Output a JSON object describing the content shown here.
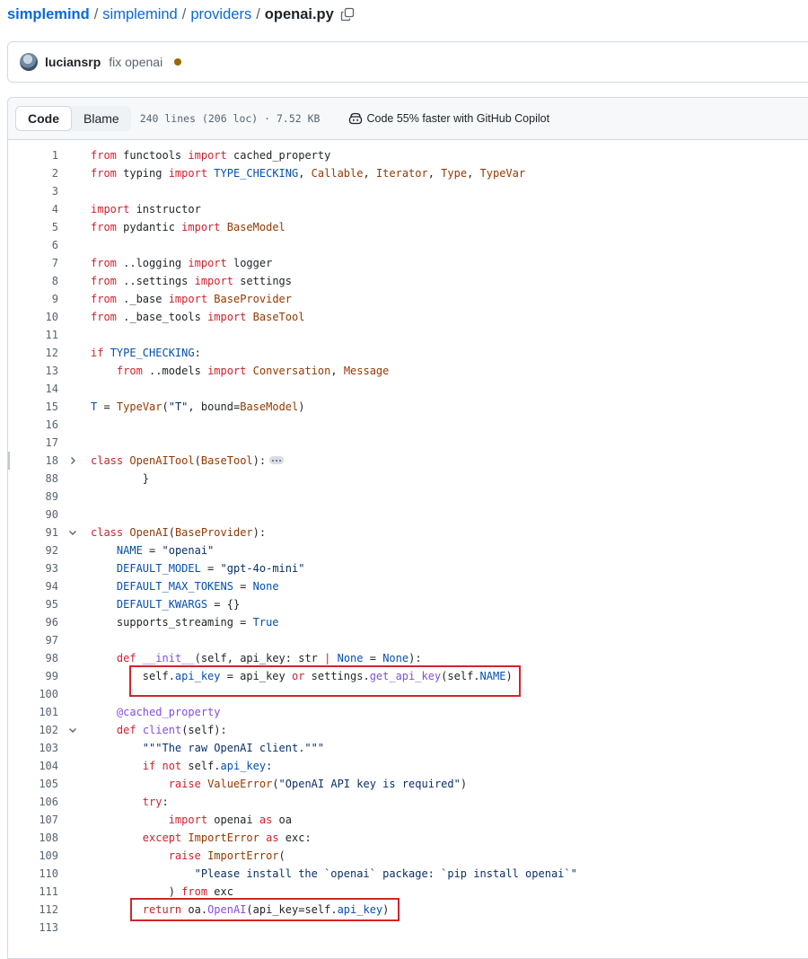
{
  "breadcrumb": {
    "repo": "simplemind",
    "sep": "/",
    "dir1": "simplemind",
    "dir2": "providers",
    "file": "openai.py"
  },
  "commit": {
    "author": "luciansrp",
    "message": "fix openai",
    "status_color": "#9a6700"
  },
  "file_header": {
    "code_tab": "Code",
    "blame_tab": "Blame",
    "meta": "240 lines (206 loc) · 7.52 KB",
    "copilot_label": "Code 55% faster with GitHub Copilot"
  },
  "code_lines": [
    {
      "n": "1",
      "html": "<span class=\"k\">from</span> functools <span class=\"k\">import</span> cached_property"
    },
    {
      "n": "2",
      "html": "<span class=\"k\">from</span> typing <span class=\"k\">import</span> <span class=\"b\">TYPE_CHECKING</span>, <span class=\"c\">Callable</span>, <span class=\"c\">Iterator</span>, <span class=\"c\">Type</span>, <span class=\"c\">TypeVar</span>"
    },
    {
      "n": "3",
      "html": ""
    },
    {
      "n": "4",
      "html": "<span class=\"k\">import</span> instructor"
    },
    {
      "n": "5",
      "html": "<span class=\"k\">from</span> pydantic <span class=\"k\">import</span> <span class=\"c\">BaseModel</span>"
    },
    {
      "n": "6",
      "html": ""
    },
    {
      "n": "7",
      "html": "<span class=\"k\">from</span> ..logging <span class=\"k\">import</span> logger"
    },
    {
      "n": "8",
      "html": "<span class=\"k\">from</span> ..settings <span class=\"k\">import</span> settings"
    },
    {
      "n": "9",
      "html": "<span class=\"k\">from</span> ._base <span class=\"k\">import</span> <span class=\"c\">BaseProvider</span>"
    },
    {
      "n": "10",
      "html": "<span class=\"k\">from</span> ._base_tools <span class=\"k\">import</span> <span class=\"c\">BaseTool</span>"
    },
    {
      "n": "11",
      "html": ""
    },
    {
      "n": "12",
      "html": "<span class=\"k\">if</span> <span class=\"b\">TYPE_CHECKING</span>:"
    },
    {
      "n": "13",
      "html": "    <span class=\"k\">from</span> ..models <span class=\"k\">import</span> <span class=\"c\">Conversation</span>, <span class=\"c\">Message</span>"
    },
    {
      "n": "14",
      "html": ""
    },
    {
      "n": "15",
      "html": "<span class=\"b\">T</span> = <span class=\"c\">TypeVar</span>(<span class=\"s\">\"T\"</span>, bound=<span class=\"c\">BaseModel</span>)"
    },
    {
      "n": "16",
      "html": ""
    },
    {
      "n": "17",
      "html": ""
    },
    {
      "n": "18",
      "fold": "right",
      "sel": true,
      "ellipsis": true,
      "html": "<span class=\"k\">class</span> <span class=\"c\">OpenAITool</span>(<span class=\"c\">BaseTool</span>):"
    },
    {
      "n": "88",
      "html": "        }"
    },
    {
      "n": "89",
      "html": ""
    },
    {
      "n": "90",
      "html": ""
    },
    {
      "n": "91",
      "fold": "down",
      "html": "<span class=\"k\">class</span> <span class=\"c\">OpenAI</span>(<span class=\"c\">BaseProvider</span>):"
    },
    {
      "n": "92",
      "html": "    <span class=\"b\">NAME</span> = <span class=\"s\">\"openai\"</span>"
    },
    {
      "n": "93",
      "html": "    <span class=\"b\">DEFAULT_MODEL</span> = <span class=\"s\">\"gpt-4o-mini\"</span>"
    },
    {
      "n": "94",
      "html": "    <span class=\"b\">DEFAULT_MAX_TOKENS</span> = <span class=\"b\">None</span>"
    },
    {
      "n": "95",
      "html": "    <span class=\"b\">DEFAULT_KWARGS</span> = {}"
    },
    {
      "n": "96",
      "html": "    supports_streaming = <span class=\"b\">True</span>"
    },
    {
      "n": "97",
      "html": ""
    },
    {
      "n": "98",
      "html": "    <span class=\"k\">def</span> <span class=\"f\">__init__</span>(self, api_key: str <span class=\"k\">|</span> <span class=\"b\">None</span> = <span class=\"b\">None</span>):"
    },
    {
      "n": "99",
      "html": "        self.<span class=\"b\">api_key</span> = api_key <span class=\"k\">or</span> settings.<span class=\"f\">get_api_key</span>(self.<span class=\"b\">NAME</span>)"
    },
    {
      "n": "100",
      "html": ""
    },
    {
      "n": "101",
      "html": "    <span class=\"f\">@cached_property</span>"
    },
    {
      "n": "102",
      "fold": "down",
      "html": "    <span class=\"k\">def</span> <span class=\"f\">client</span>(self):"
    },
    {
      "n": "103",
      "html": "        <span class=\"s\">\"\"\"The raw OpenAI client.\"\"\"</span>"
    },
    {
      "n": "104",
      "html": "        <span class=\"k\">if</span> <span class=\"k\">not</span> self.<span class=\"b\">api_key</span>:"
    },
    {
      "n": "105",
      "html": "            <span class=\"k\">raise</span> <span class=\"c\">ValueError</span>(<span class=\"s\">\"OpenAI API key is required\"</span>)"
    },
    {
      "n": "106",
      "html": "        <span class=\"k\">try</span>:"
    },
    {
      "n": "107",
      "html": "            <span class=\"k\">import</span> openai <span class=\"k\">as</span> oa"
    },
    {
      "n": "108",
      "html": "        <span class=\"k\">except</span> <span class=\"c\">ImportError</span> <span class=\"k\">as</span> exc:"
    },
    {
      "n": "109",
      "html": "            <span class=\"k\">raise</span> <span class=\"c\">ImportError</span>("
    },
    {
      "n": "110",
      "html": "                <span class=\"s\">\"Please install the `openai` package: `pip install openai`\"</span>"
    },
    {
      "n": "111",
      "html": "            ) <span class=\"k\">from</span> exc"
    },
    {
      "n": "112",
      "html": "        <span class=\"k\">return</span> oa.<span class=\"f\">OpenAI</span>(api_key=self.<span class=\"b\">api_key</span>)"
    },
    {
      "n": "113",
      "html": ""
    }
  ]
}
